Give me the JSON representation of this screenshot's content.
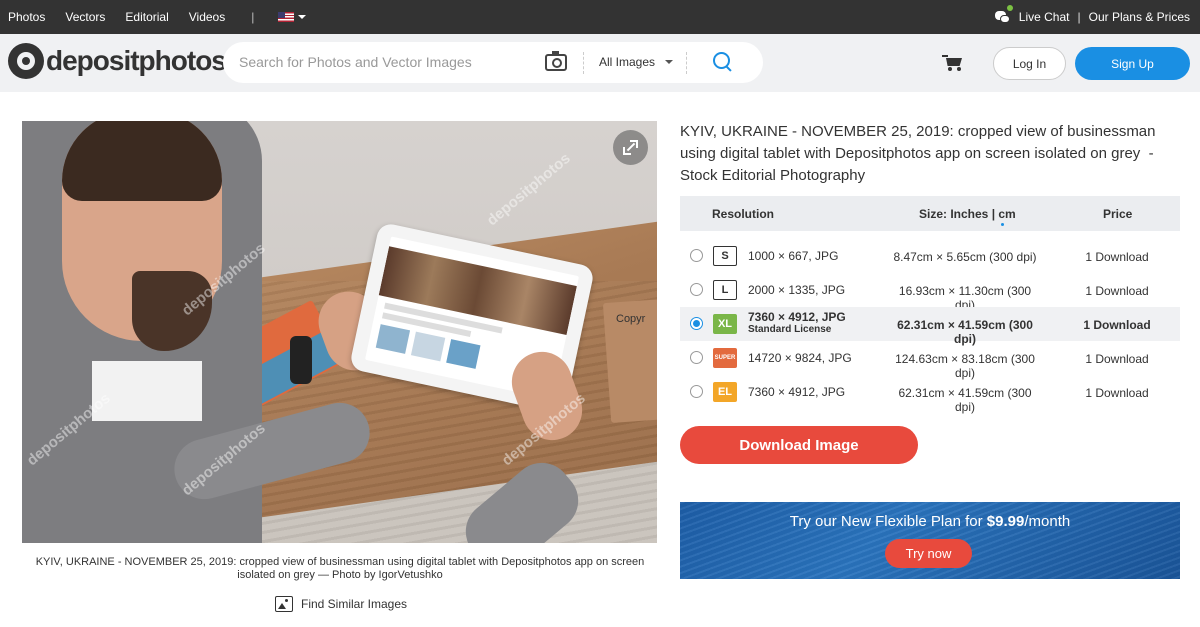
{
  "topbar": {
    "nav": [
      "Photos",
      "Vectors",
      "Editorial",
      "Videos"
    ],
    "divider": "|",
    "live_chat": "Live Chat",
    "separator": "|",
    "plans": "Our Plans & Prices"
  },
  "header": {
    "logo_text": "depositphotos",
    "logo_mark": "®",
    "search_placeholder": "Search for Photos and Vector Images",
    "filter_selected": "All Images",
    "login": "Log In",
    "signup": "Sign Up"
  },
  "image": {
    "watermark": "depositphotos",
    "inner_text": "Copyr",
    "caption": "KYIV, UKRAINE - NOVEMBER 25, 2019: cropped view of businessman using digital tablet with Depositphotos app on screen isolated on grey — Photo by IgorVetushko",
    "find_similar": "Find Similar Images"
  },
  "detail": {
    "title": "KYIV, UKRAINE - NOVEMBER 25, 2019: cropped view of businessman using digital tablet with Depositphotos app on screen isolated on grey  - Stock Editorial Photography",
    "columns": {
      "resolution": "Resolution",
      "size": "Size: Inches | cm",
      "price": "Price"
    },
    "rows": [
      {
        "badge": "S",
        "resolution": "1000 × 667, JPG",
        "size": "8.47cm × 5.65cm (300 dpi)",
        "price": "1 Download"
      },
      {
        "badge": "L",
        "resolution": "2000 × 1335, JPG",
        "size": "16.93cm × 11.30cm (300 dpi)",
        "price": "1 Download"
      },
      {
        "badge": "XL",
        "resolution": "7360 × 4912, JPG",
        "license": "Standard License",
        "size": "62.31cm × 41.59cm (300 dpi)",
        "price": "1 Download"
      },
      {
        "badge": "SUPER",
        "resolution": "14720 × 9824, JPG",
        "size": "124.63cm × 83.18cm (300 dpi)",
        "price": "1 Download"
      },
      {
        "badge": "EL",
        "resolution": "7360 × 4912, JPG",
        "size": "62.31cm × 41.59cm (300 dpi)",
        "price": "1 Download"
      }
    ],
    "selected_row": 2,
    "download_button": "Download Image"
  },
  "promo": {
    "text_before": "Try our New Flexible Plan for ",
    "price": "$9.99",
    "text_after": "/month",
    "button": "Try now"
  },
  "colors": {
    "topbar": "#333333",
    "accent_blue": "#1a8fe3",
    "download_red": "#e84a3d",
    "xl_green": "#7ab648",
    "el_orange": "#f3a628"
  }
}
